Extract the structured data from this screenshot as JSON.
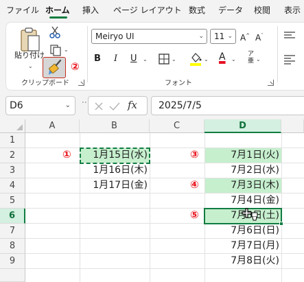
{
  "menu": {
    "tabs": [
      "ファイル",
      "ホーム",
      "挿入",
      "ページ レイアウト",
      "数式",
      "データ",
      "校閲",
      "表示"
    ],
    "active_tab": "ホーム"
  },
  "ribbon": {
    "clipboard": {
      "paste_label": "貼り付け",
      "group_label": "クリップボード",
      "format_painter_icon": "paintbrush-icon",
      "cut_icon": "scissors-icon",
      "copy_icon": "copy-icon"
    },
    "font": {
      "font_name": "Meiryo UI",
      "font_size": "11",
      "bold": "B",
      "italic": "I",
      "underline": "U",
      "font_color_letter": "A",
      "group_label": "フォント",
      "font_color": "#e81123",
      "fill_color": "#ffff00"
    }
  },
  "markers": {
    "m1": "①",
    "m2": "②",
    "m3": "③",
    "m4": "④",
    "m5": "⑤"
  },
  "formula_bar": {
    "name_box": "D6",
    "fx": "fx",
    "formula": "2025/7/5"
  },
  "sheet": {
    "columns": [
      "A",
      "B",
      "C",
      "D"
    ],
    "rows": [
      "1",
      "2",
      "3",
      "4",
      "5",
      "6",
      "7",
      "8",
      "9"
    ],
    "selected_column": "D",
    "selected_row": "6",
    "column_b": [
      "1月15日(水)",
      "1月16日(木)",
      "1月17日(金)"
    ],
    "column_d": [
      "7月1日(火)",
      "7月2日(水)",
      "7月3日(木)",
      "7月4日(金)",
      "7月5日(土)",
      "7月6日(日)",
      "7月7日(月)",
      "7月8日(火)"
    ],
    "highlight_color": "#c6efce",
    "accent_color": "#107c41"
  }
}
